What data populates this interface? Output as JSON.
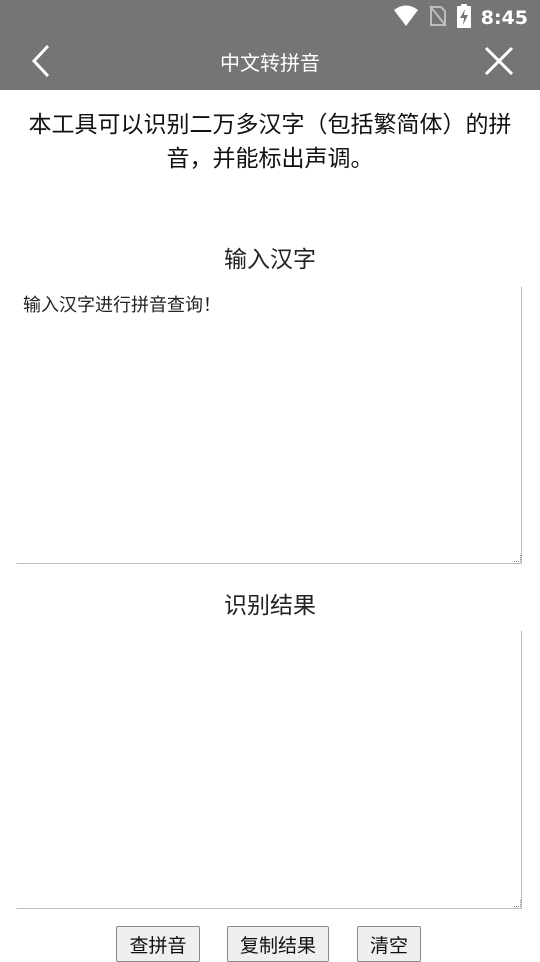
{
  "status_bar": {
    "time": "8:45",
    "icons": [
      "wifi-icon",
      "no-sim-icon",
      "battery-charging-icon"
    ]
  },
  "toolbar": {
    "title": "中文转拼音",
    "back_icon": "chevron-left-icon",
    "close_icon": "close-icon",
    "background_color": "#757575"
  },
  "intro_text": "本工具可以识别二万多汉字（包括繁简体）的拼音，并能标出声调。",
  "input_section": {
    "label": "输入汉字",
    "placeholder": "输入汉字进行拼音查询！",
    "value": ""
  },
  "result_section": {
    "label": "识别结果",
    "value": ""
  },
  "buttons": {
    "lookup": "查拼音",
    "copy": "复制结果",
    "clear": "清空"
  }
}
